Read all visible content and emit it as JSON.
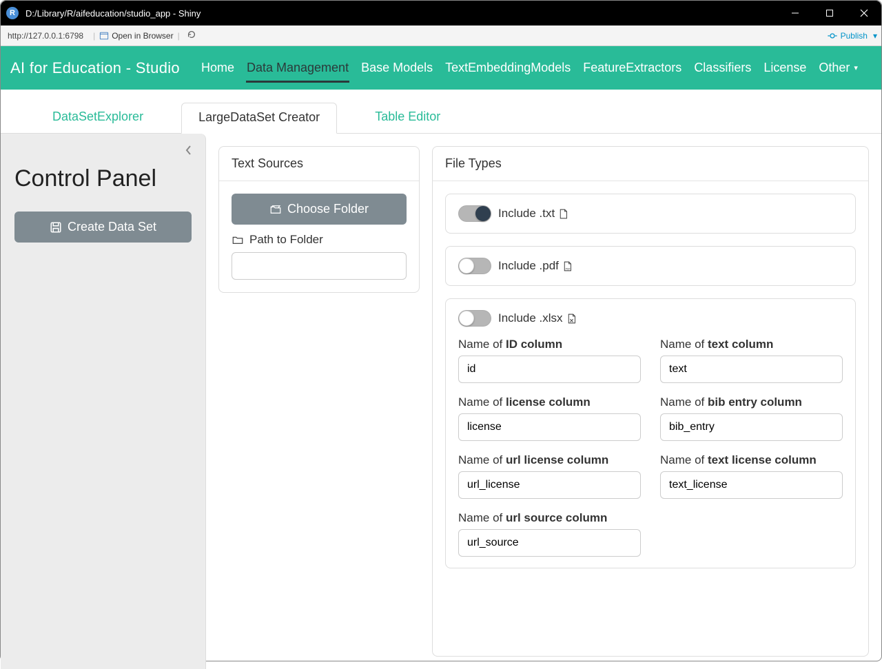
{
  "window": {
    "title": "D:/Library/R/aifeducation/studio_app - Shiny",
    "r_icon": "R"
  },
  "toolbar": {
    "url": "http://127.0.0.1:6798",
    "open_browser": "Open in Browser",
    "publish": "Publish"
  },
  "navbar": {
    "brand": "AI for Education - Studio",
    "items": [
      "Home",
      "Data Management",
      "Base Models",
      "TextEmbeddingModels",
      "FeatureExtractors",
      "Classifiers",
      "License",
      "Other"
    ],
    "active_index": 1,
    "other_caret": "▾"
  },
  "subtabs": {
    "items": [
      "DataSetExplorer",
      "LargeDataSet Creator",
      "Table Editor"
    ],
    "active_index": 1
  },
  "sidebar": {
    "title": "Control Panel",
    "create_btn": "Create Data Set"
  },
  "text_sources": {
    "header": "Text Sources",
    "choose_folder": "Choose Folder",
    "path_label": "Path to Folder",
    "path_value": ""
  },
  "file_types": {
    "header": "File Types",
    "txt": {
      "label": "Include .txt",
      "on": true
    },
    "pdf": {
      "label": "Include .pdf",
      "on": false
    },
    "xlsx": {
      "label": "Include .xlsx",
      "on": false,
      "fields": {
        "id": {
          "label_pre": "Name of ",
          "label_b": "ID column",
          "value": "id"
        },
        "text": {
          "label_pre": "Name of ",
          "label_b": "text column",
          "value": "text"
        },
        "license": {
          "label_pre": "Name of ",
          "label_b": "license column",
          "value": "license"
        },
        "bib_entry": {
          "label_pre": "Name of ",
          "label_b": "bib entry column",
          "value": "bib_entry"
        },
        "url_license": {
          "label_pre": "Name of ",
          "label_b": "url license column",
          "value": "url_license"
        },
        "text_license": {
          "label_pre": "Name of ",
          "label_b": "text license column",
          "value": "text_license"
        },
        "url_source": {
          "label_pre": "Name of ",
          "label_b": "url source column",
          "value": "url_source"
        }
      }
    }
  }
}
